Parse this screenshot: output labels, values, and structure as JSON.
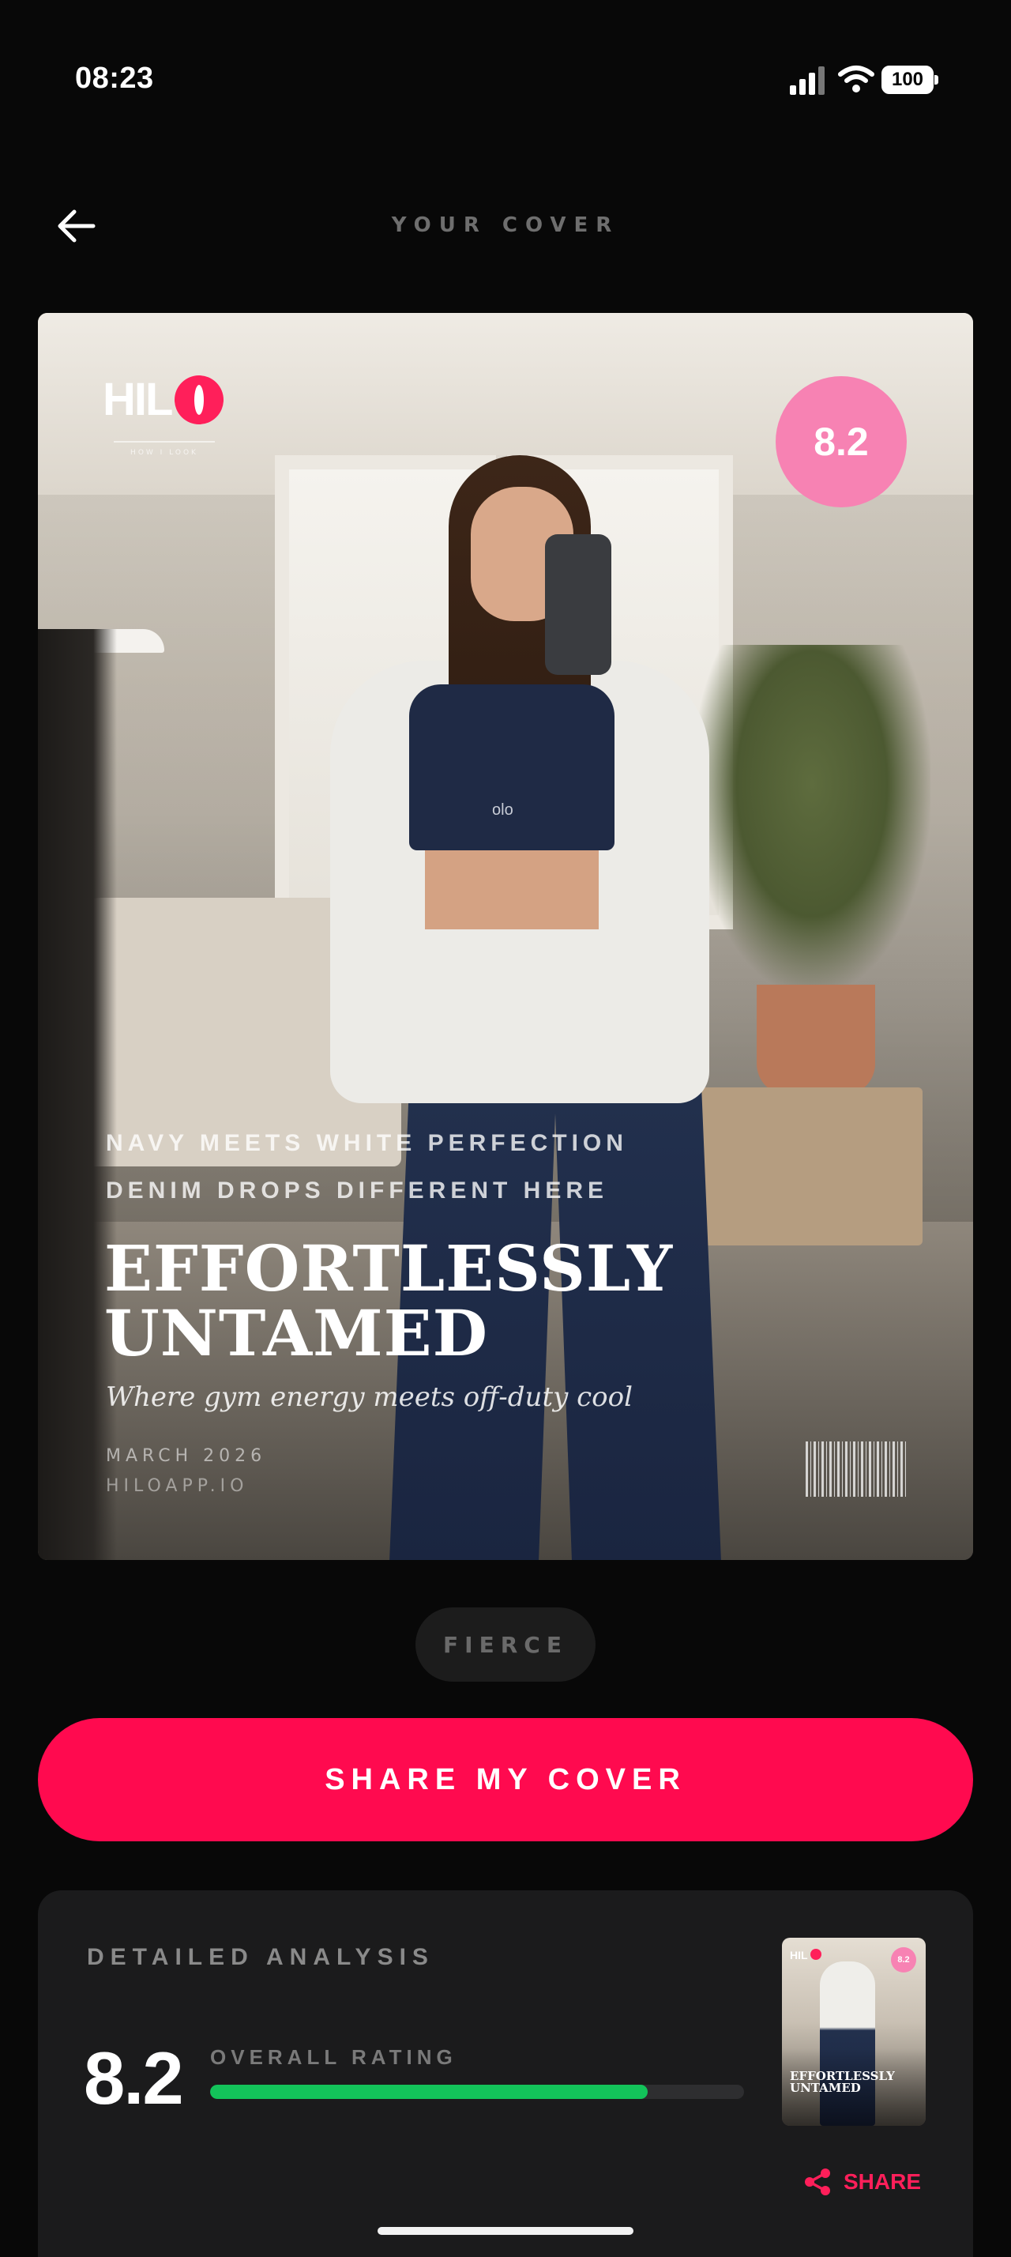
{
  "status": {
    "time": "08:23",
    "battery": "100"
  },
  "header": {
    "title": "YOUR COVER"
  },
  "cover": {
    "logo_text": "HIL",
    "logo_tagline": "HOW I LOOK",
    "score": "8.2",
    "kicker_1": "NAVY MEETS WHITE PERFECTION",
    "kicker_2": "DENIM DROPS DIFFERENT HERE",
    "headline": "EFFORTLESSLY UNTAMED",
    "subhead": "Where gym energy meets off-duty cool",
    "date": "MARCH 2026",
    "site": "HILOAPP.IO",
    "top_brand": "olo"
  },
  "style_chip": {
    "label": "FIERCE"
  },
  "actions": {
    "share_cover": "SHARE MY COVER"
  },
  "analysis": {
    "title": "DETAILED ANALYSIS",
    "score": "8.2",
    "overall_label": "OVERALL RATING",
    "overall_fraction": 0.82,
    "share_label": "SHARE",
    "thumb_logo": "HIL",
    "thumb_score": "8.2",
    "thumb_headline": "EFFORTLESSLY UNTAMED"
  },
  "colors": {
    "accent": "#ff0a4f",
    "score_badge": "#f782b3",
    "rating_bar": "#13c35a",
    "background": "#080808"
  },
  "icons": {
    "back": "arrow-left-icon",
    "share": "share-icon",
    "signal": "signal-icon",
    "wifi": "wifi-icon",
    "battery": "battery-icon"
  }
}
